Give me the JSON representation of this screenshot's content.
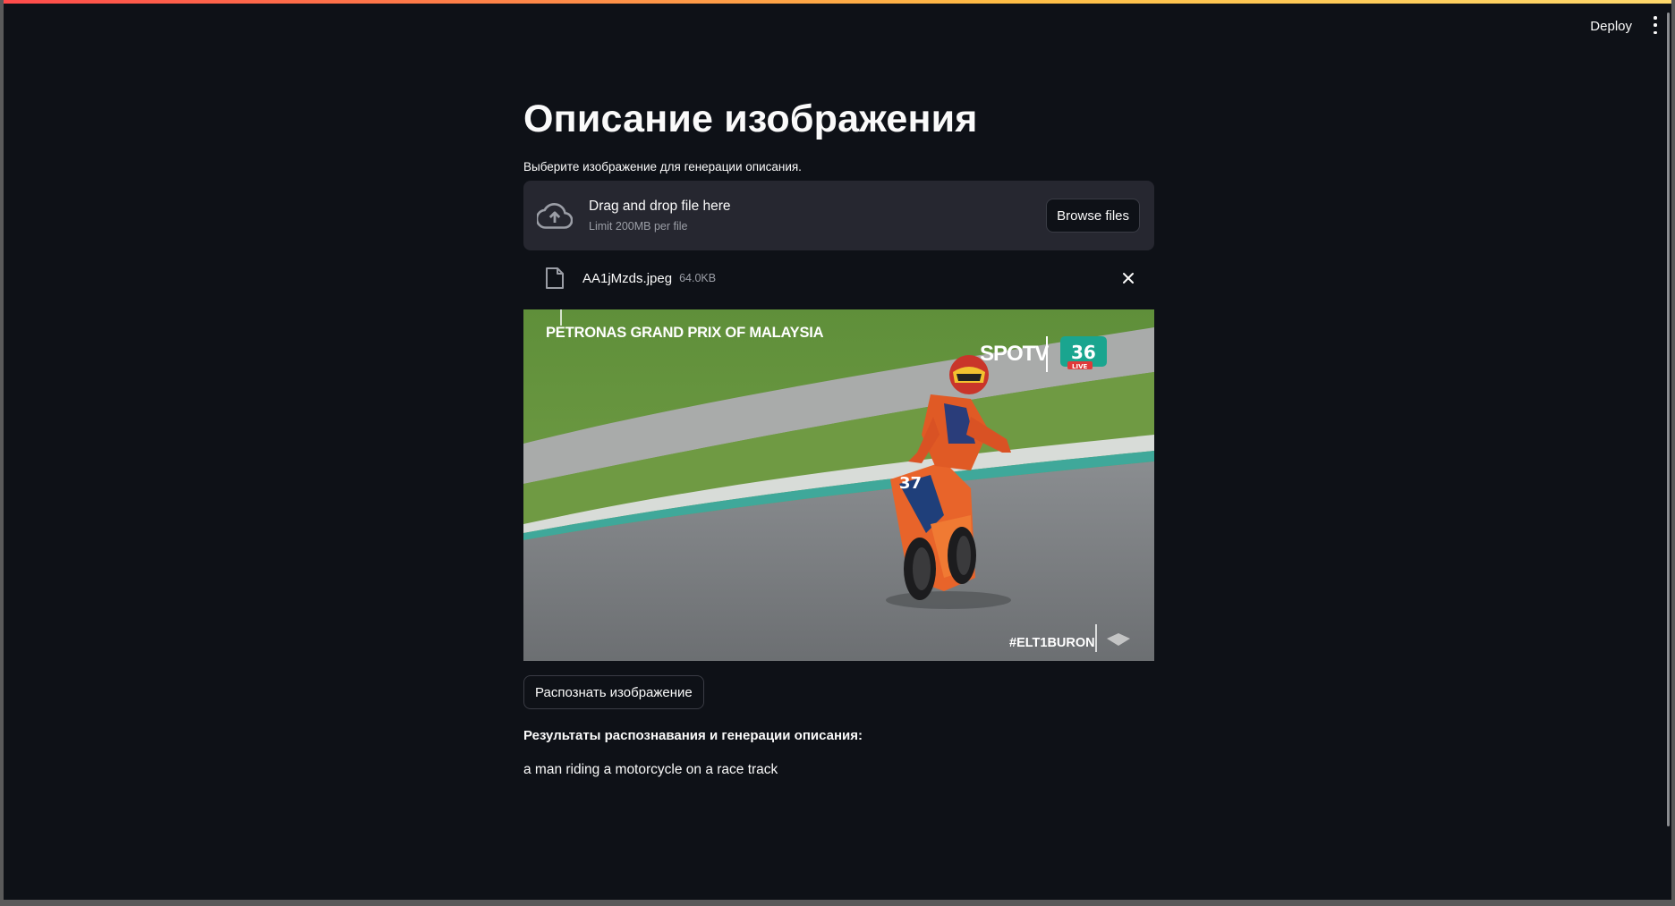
{
  "header": {
    "deploy_label": "Deploy",
    "menu_icon": "kebab-menu-icon"
  },
  "main": {
    "title": "Описание изображения",
    "uploader_label": "Выберите изображение для генерации описания.",
    "dropzone": {
      "icon": "cloud-upload-icon",
      "main_text": "Drag and drop file here",
      "sub_text": "Limit 200MB per file",
      "browse_label": "Browse files"
    },
    "uploaded_file": {
      "icon": "file-icon",
      "name": "AA1jMzds.jpeg",
      "size": "64.0KB",
      "remove_icon": "close-icon"
    },
    "image": {
      "overlay_title": "PETRONAS GRAND PRIX OF MALAYSIA",
      "overlay_channel": "SPOTV",
      "overlay_badge": "36",
      "overlay_badge_sub": "LIVE",
      "overlay_hashtag": "#ELT1BURON"
    },
    "recognize_label": "Распознать изображение",
    "results_title": "Результаты распознавания и генерации описания:",
    "results_text": "a man riding a motorcycle on a race track"
  },
  "colors": {
    "background": "#0e1117",
    "panel": "#262730",
    "text": "#fafafa",
    "muted": "#9b9ea6",
    "accent_gradient_start": "#ff4b4b",
    "accent_gradient_end": "#ffd86b"
  }
}
